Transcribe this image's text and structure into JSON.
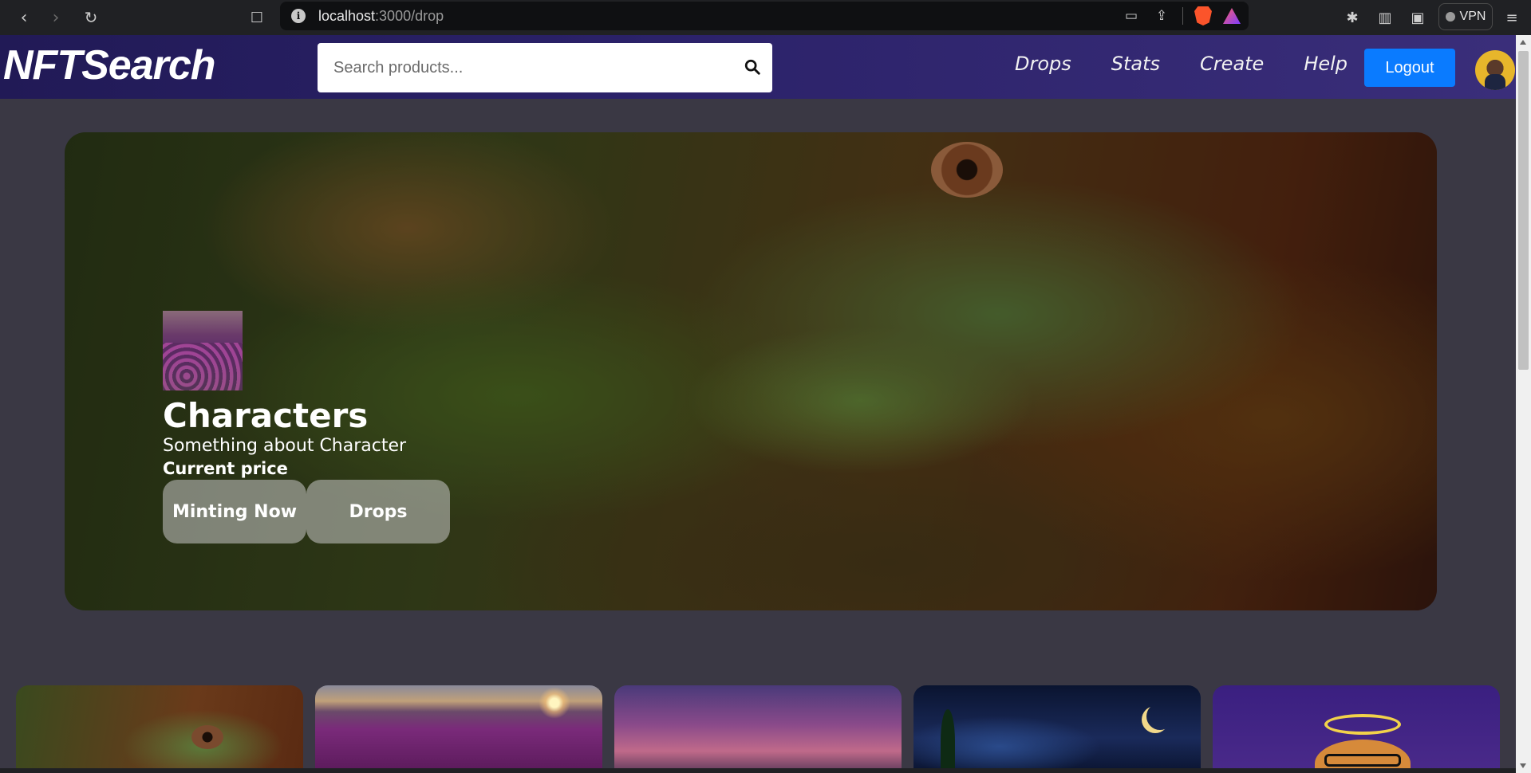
{
  "browser": {
    "url_host": "localhost",
    "url_rest": ":3000/drop",
    "vpn_label": "VPN",
    "icons": [
      "back-icon",
      "forward-icon",
      "reload-icon",
      "bookmark-icon",
      "info-icon",
      "cast-icon",
      "share-icon",
      "brave-shields-icon",
      "brave-rewards-icon",
      "extensions-icon",
      "sidebar-icon",
      "wallet-icon",
      "menu-icon"
    ]
  },
  "navbar": {
    "brand": "NFTSearch",
    "search_placeholder": "Search products...",
    "links": [
      "Drops",
      "Stats",
      "Create",
      "Help"
    ],
    "logout_label": "Logout",
    "accent_color": "#0a7bff"
  },
  "hero": {
    "title": "Characters",
    "subtitle": "Something about Character",
    "price_label": "Current price",
    "buttons": {
      "minting": "Minting Now",
      "drops": "Drops"
    }
  },
  "cards": [
    {
      "image": "iguana"
    },
    {
      "image": "tulip-field-sunset"
    },
    {
      "image": "pink-sky-mountains"
    },
    {
      "image": "starry-night-moon"
    },
    {
      "image": "ape-with-halo"
    }
  ]
}
